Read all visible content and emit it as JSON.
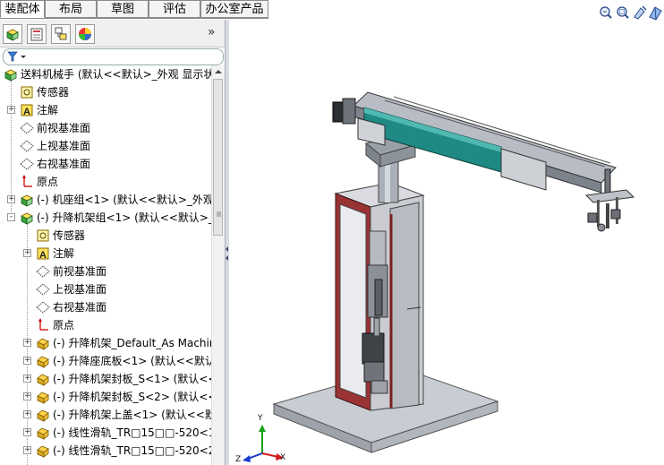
{
  "tabs": [
    {
      "label": "装配体",
      "active": true
    },
    {
      "label": "布局",
      "active": false
    },
    {
      "label": "草图",
      "active": false
    },
    {
      "label": "评估",
      "active": false
    },
    {
      "label": "办公室产品",
      "active": false
    }
  ],
  "panel": {
    "expand_label": "»",
    "tree": [
      {
        "text": "送料机械手  (默认<<默认>_外观 显示状",
        "icon": "assembly-icon",
        "expander": "none"
      },
      {
        "text": "传感器",
        "icon": "sensor-icon",
        "expander": "none"
      },
      {
        "text": "注解",
        "icon": "annotation-icon",
        "expander": "+"
      },
      {
        "text": "前视基准面",
        "icon": "plane-icon",
        "expander": "none"
      },
      {
        "text": "上视基准面",
        "icon": "plane-icon",
        "expander": "none"
      },
      {
        "text": "右视基准面",
        "icon": "plane-icon",
        "expander": "none"
      },
      {
        "text": "原点",
        "icon": "origin-icon",
        "expander": "none"
      },
      {
        "text": "(-) 机座组<1> (默认<<默认>_外观",
        "icon": "subassembly-icon",
        "expander": "+"
      },
      {
        "text": "(-) 升降机架组<1> (默认<<默认>_外",
        "icon": "subassembly-icon",
        "expander": "-"
      },
      {
        "text": "传感器",
        "icon": "sensor-icon",
        "expander": "none"
      },
      {
        "text": "注解",
        "icon": "annotation-icon",
        "expander": "+"
      },
      {
        "text": "前视基准面",
        "icon": "plane-icon",
        "expander": "none"
      },
      {
        "text": "上视基准面",
        "icon": "plane-icon",
        "expander": "none"
      },
      {
        "text": "右视基准面",
        "icon": "plane-icon",
        "expander": "none"
      },
      {
        "text": "原点",
        "icon": "origin-icon",
        "expander": "none"
      },
      {
        "text": "(-) 升降机架_Default_As Machin",
        "icon": "part-icon",
        "expander": "+"
      },
      {
        "text": "(-) 升降座底板<1> (默认<<默认",
        "icon": "part-icon",
        "expander": "+"
      },
      {
        "text": "(-) 升降机架封板_S<1> (默认<<",
        "icon": "part-icon",
        "expander": "+"
      },
      {
        "text": "(-) 升降机架封板_S<2> (默认<<",
        "icon": "part-icon",
        "expander": "+"
      },
      {
        "text": "(-) 升降机架上盖<1> (默认<<默",
        "icon": "part-icon",
        "expander": "+"
      },
      {
        "text": "(-) 线性滑轨_TR□15□□-520<1>",
        "icon": "part-icon",
        "expander": "+"
      },
      {
        "text": "(-) 线性滑轨_TR□15□□-520<2>",
        "icon": "part-icon",
        "expander": "+"
      }
    ]
  },
  "colors": {
    "frame_red": "#8b2a2a",
    "sheet_metal": "#c7c7cc",
    "conveyor_teal": "#1e8a83",
    "dark_steel": "#6f7378"
  },
  "triad": {
    "x": "X",
    "y": "Y",
    "z": "Z"
  }
}
